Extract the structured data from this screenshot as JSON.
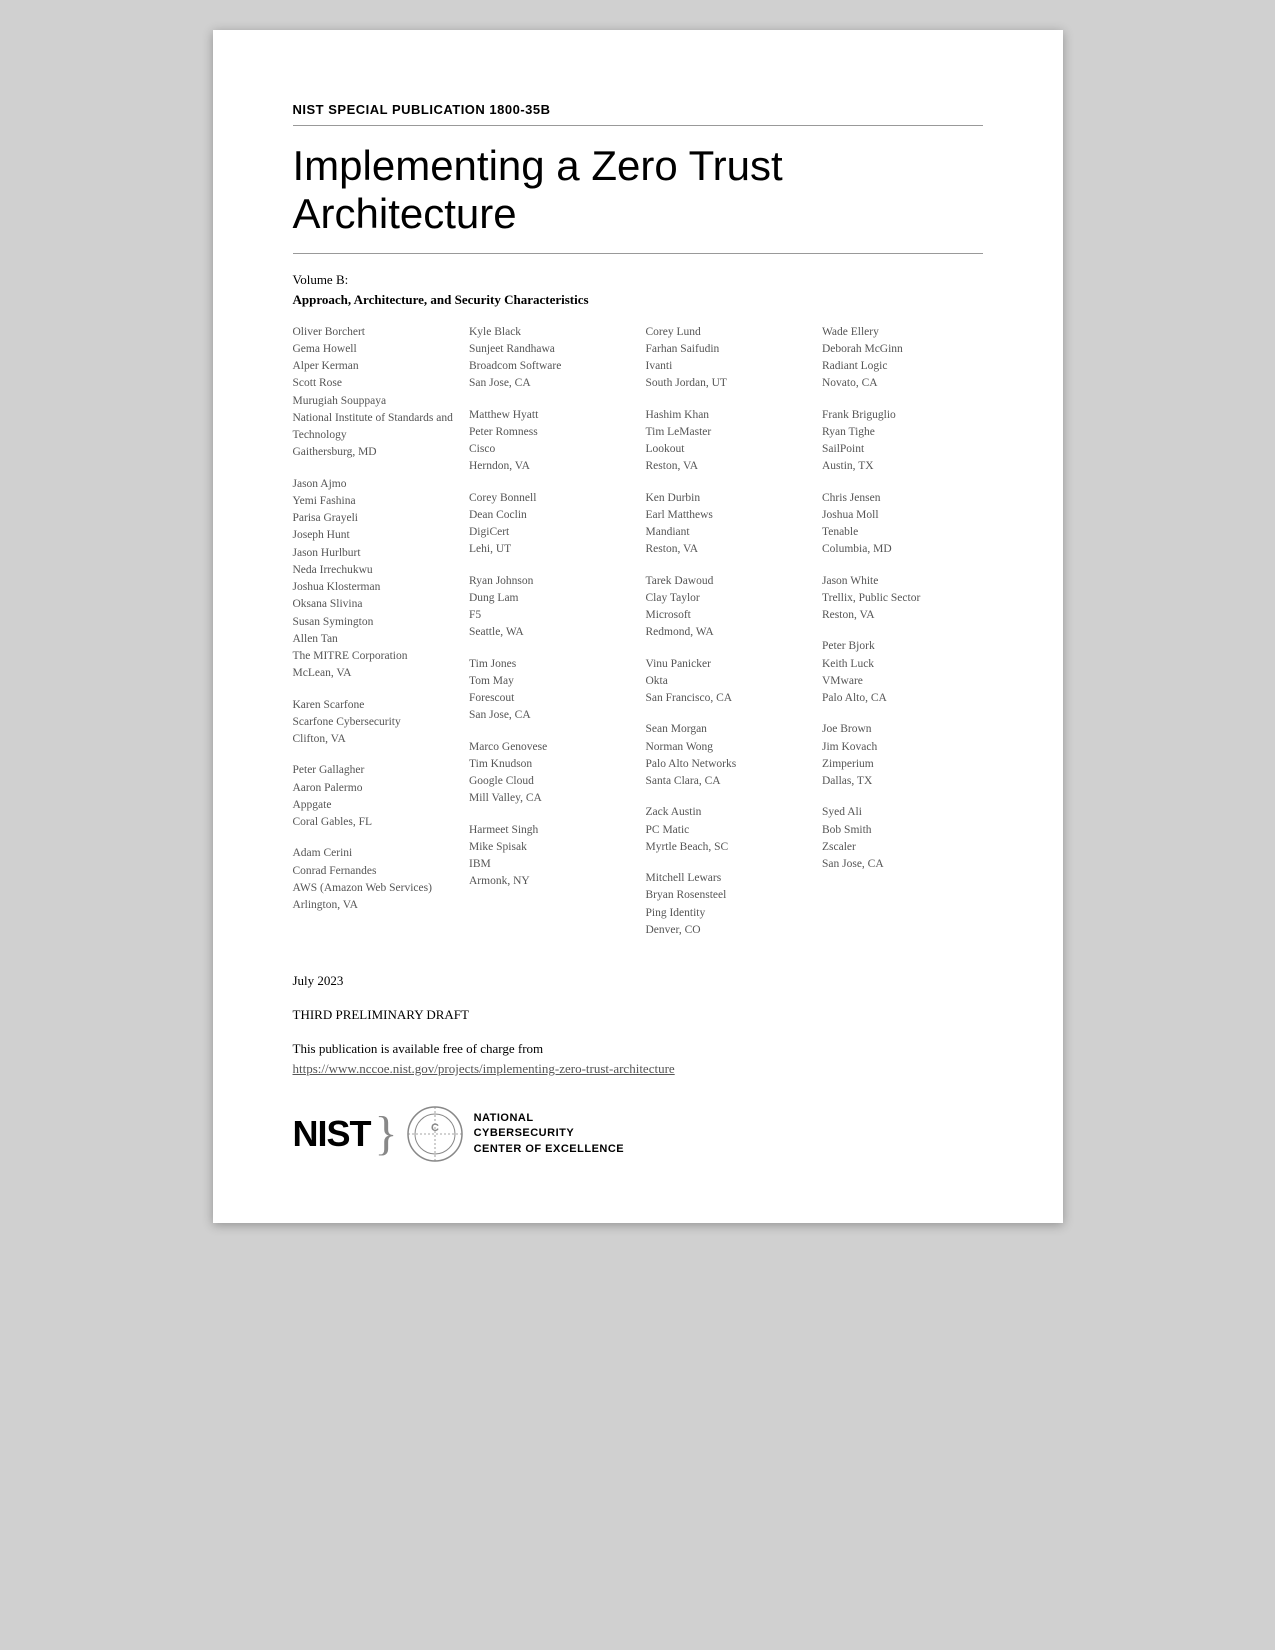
{
  "publication": {
    "number": "NIST SPECIAL PUBLICATION 1800-35B",
    "title": "Implementing a Zero Trust Architecture",
    "volume_label": "Volume B:",
    "volume_subtitle": "Approach, Architecture, and Security Characteristics"
  },
  "columns": [
    {
      "blocks": [
        {
          "names": [
            "Oliver Borchert",
            "Gema Howell",
            "Alper Kerman",
            "Scott Rose",
            "Murugiah Souppaya"
          ],
          "org": "National Institute of Standards and Technology",
          "loc": "Gaithersburg, MD"
        },
        {
          "names": [
            "Jason Ajmo",
            "Yemi Fashina",
            "Parisa Grayeli",
            "Joseph Hunt",
            "Jason Hurlburt",
            "Neda Irrechukwu",
            "Joshua Klosterman",
            "Oksana Slivina",
            "Susan Symington",
            "Allen Tan"
          ],
          "org": "The MITRE Corporation",
          "loc": "McLean, VA"
        },
        {
          "names": [
            "Karen Scarfone"
          ],
          "org": "Scarfone Cybersecurity",
          "loc": "Clifton, VA"
        },
        {
          "names": [
            "Peter Gallagher",
            "Aaron Palermo"
          ],
          "org": "Appgate",
          "loc": "Coral Gables, FL"
        },
        {
          "names": [
            "Adam Cerini",
            "Conrad Fernandes"
          ],
          "org": "AWS (Amazon Web Services)",
          "loc": "Arlington, VA"
        }
      ]
    },
    {
      "blocks": [
        {
          "names": [
            "Kyle Black",
            "Sunjeet Randhawa"
          ],
          "org": "Broadcom Software",
          "loc": "San Jose, CA"
        },
        {
          "names": [
            "Matthew Hyatt",
            "Peter Romness"
          ],
          "org": "Cisco",
          "loc": "Herndon, VA"
        },
        {
          "names": [
            "Corey Bonnell",
            "Dean Coclin"
          ],
          "org": "DigiCert",
          "loc": "Lehi, UT"
        },
        {
          "names": [
            "Ryan Johnson",
            "Dung Lam"
          ],
          "org": "F5",
          "loc": "Seattle, WA"
        },
        {
          "names": [
            "Tim Jones",
            "Tom May"
          ],
          "org": "Forescout",
          "loc": "San Jose, CA"
        },
        {
          "names": [
            "Marco Genovese",
            "Tim Knudson"
          ],
          "org": "Google Cloud",
          "loc": "Mill Valley, CA"
        },
        {
          "names": [
            "Harmeet Singh",
            "Mike Spisak"
          ],
          "org": "IBM",
          "loc": "Armonk, NY"
        }
      ]
    },
    {
      "blocks": [
        {
          "names": [
            "Corey Lund",
            "Farhan Saifudin"
          ],
          "org": "Ivanti",
          "loc": "South Jordan, UT"
        },
        {
          "names": [
            "Hashim Khan",
            "Tim LeMaster"
          ],
          "org": "Lookout",
          "loc": "Reston, VA"
        },
        {
          "names": [
            "Ken Durbin",
            "Earl Matthews"
          ],
          "org": "Mandiant",
          "loc": "Reston, VA"
        },
        {
          "names": [
            "Tarek Dawoud",
            "Clay Taylor"
          ],
          "org": "Microsoft",
          "loc": "Redmond, WA"
        },
        {
          "names": [
            "Vinu Panicker"
          ],
          "org": "Okta",
          "loc": "San Francisco, CA"
        },
        {
          "names": [
            "Sean Morgan",
            "Norman Wong"
          ],
          "org": "Palo Alto Networks",
          "loc": "Santa Clara, CA"
        },
        {
          "names": [
            "Zack Austin"
          ],
          "org": "PC Matic",
          "loc": "Myrtle Beach, SC"
        },
        {
          "names": [
            "Mitchell Lewars",
            "Bryan Rosensteel"
          ],
          "org": "Ping Identity",
          "loc": "Denver, CO"
        }
      ]
    },
    {
      "blocks": [
        {
          "names": [
            "Wade Ellery",
            "Deborah McGinn"
          ],
          "org": "Radiant Logic",
          "loc": "Novato, CA"
        },
        {
          "names": [
            "Frank Briguglio",
            "Ryan Tighe"
          ],
          "org": "SailPoint",
          "loc": "Austin, TX"
        },
        {
          "names": [
            "Chris Jensen",
            "Joshua Moll"
          ],
          "org": "Tenable",
          "loc": "Columbia, MD"
        },
        {
          "names": [
            "Jason White"
          ],
          "org": "Trellix, Public Sector",
          "loc": "Reston, VA"
        },
        {
          "names": [
            "Peter Bjork",
            "Keith Luck"
          ],
          "org": "VMware",
          "loc": "Palo Alto, CA"
        },
        {
          "names": [
            "Joe Brown",
            "Jim Kovach"
          ],
          "org": "Zimperium",
          "loc": "Dallas, TX"
        },
        {
          "names": [
            "Syed Ali",
            "Bob Smith"
          ],
          "org": "Zscaler",
          "loc": "San Jose, CA"
        }
      ]
    }
  ],
  "date": "July 2023",
  "draft_status": "THIRD PRELIMINARY DRAFT",
  "availability": {
    "text": "This publication is available free of charge from",
    "url": "https://www.nccoe.nist.gov/projects/implementing-zero-trust-architecture"
  },
  "logo": {
    "nist": "NIST",
    "org_line1": "NATIONAL",
    "org_line2": "CYBERSECURITY",
    "org_line3": "CENTER OF EXCELLENCE"
  }
}
